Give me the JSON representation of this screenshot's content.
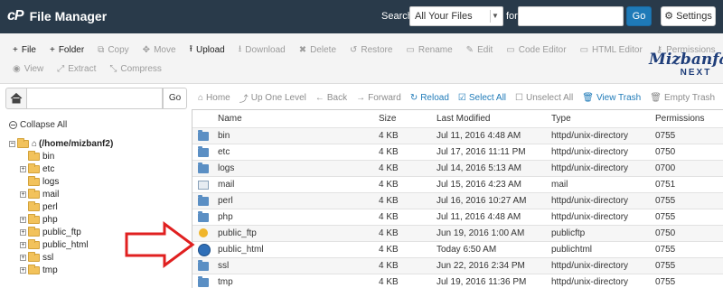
{
  "header": {
    "logo": "cP",
    "title": "File Manager",
    "search_label": "Search",
    "search_scope": "All Your Files",
    "for_label": "for",
    "search_value": "",
    "go_label": "Go",
    "settings_label": "Settings"
  },
  "toolbar": {
    "row1": [
      {
        "icon": "plus-icon",
        "glyph": "+",
        "label": "File",
        "enabled": true
      },
      {
        "icon": "plus-icon",
        "glyph": "+",
        "label": "Folder",
        "enabled": true
      },
      {
        "icon": "copy-icon",
        "glyph": "⧉",
        "label": "Copy",
        "enabled": false
      },
      {
        "icon": "move-icon",
        "glyph": "✥",
        "label": "Move",
        "enabled": false
      },
      {
        "icon": "upload-icon",
        "glyph": "⭱",
        "label": "Upload",
        "enabled": true
      },
      {
        "icon": "download-icon",
        "glyph": "⭳",
        "label": "Download",
        "enabled": false
      },
      {
        "icon": "delete-icon",
        "glyph": "✖",
        "label": "Delete",
        "enabled": false
      },
      {
        "icon": "restore-icon",
        "glyph": "↺",
        "label": "Restore",
        "enabled": false
      },
      {
        "icon": "rename-icon",
        "glyph": "▭",
        "label": "Rename",
        "enabled": false
      },
      {
        "icon": "edit-icon",
        "glyph": "✎",
        "label": "Edit",
        "enabled": false
      },
      {
        "icon": "code-editor-icon",
        "glyph": "▭",
        "label": "Code Editor",
        "enabled": false
      },
      {
        "icon": "html-editor-icon",
        "glyph": "▭",
        "label": "HTML Editor",
        "enabled": false
      },
      {
        "icon": "permissions-icon",
        "glyph": "⚷",
        "label": "Permissions",
        "enabled": false
      }
    ],
    "row2": [
      {
        "icon": "view-icon",
        "glyph": "◉",
        "label": "View",
        "enabled": false
      },
      {
        "icon": "extract-icon",
        "glyph": "⤢",
        "label": "Extract",
        "enabled": false
      },
      {
        "icon": "compress-icon",
        "glyph": "⤡",
        "label": "Compress",
        "enabled": false
      }
    ]
  },
  "watermark": {
    "line1": "Mizbanfa",
    "line2": "NEXT"
  },
  "left": {
    "path_value": "",
    "go_label": "Go",
    "collapse_label": "Collapse All",
    "root_label": "(/home/mizbanf2)",
    "tree": [
      {
        "label": "bin",
        "expandable": false
      },
      {
        "label": "etc",
        "expandable": true
      },
      {
        "label": "logs",
        "expandable": false
      },
      {
        "label": "mail",
        "expandable": true
      },
      {
        "label": "perl",
        "expandable": false
      },
      {
        "label": "php",
        "expandable": true
      },
      {
        "label": "public_ftp",
        "expandable": true
      },
      {
        "label": "public_html",
        "expandable": true
      },
      {
        "label": "ssl",
        "expandable": true
      },
      {
        "label": "tmp",
        "expandable": true
      }
    ]
  },
  "nav": [
    {
      "icon": "home-icon",
      "glyph": "⌂",
      "label": "Home",
      "enabled": false
    },
    {
      "icon": "up-level-icon",
      "glyph": "⤴",
      "label": "Up One Level",
      "enabled": false
    },
    {
      "icon": "back-icon",
      "glyph": "←",
      "label": "Back",
      "enabled": false
    },
    {
      "icon": "forward-icon",
      "glyph": "→",
      "label": "Forward",
      "enabled": false
    },
    {
      "icon": "reload-icon",
      "glyph": "↻",
      "label": "Reload",
      "enabled": true
    },
    {
      "icon": "select-all-icon",
      "glyph": "☑",
      "label": "Select All",
      "enabled": true
    },
    {
      "icon": "unselect-all-icon",
      "glyph": "☐",
      "label": "Unselect All",
      "enabled": false
    },
    {
      "icon": "trash-icon",
      "glyph": "🗑",
      "label": "View Trash",
      "enabled": true
    },
    {
      "icon": "trash-icon",
      "glyph": "🗑",
      "label": "Empty Trash",
      "enabled": false
    }
  ],
  "table": {
    "headers": {
      "name": "Name",
      "size": "Size",
      "modified": "Last Modified",
      "type": "Type",
      "permissions": "Permissions"
    },
    "rows": [
      {
        "icon": "folder",
        "name": "bin",
        "size": "4 KB",
        "modified": "Jul 11, 2016 4:48 AM",
        "type": "httpd/unix-directory",
        "perm": "0755"
      },
      {
        "icon": "folder",
        "name": "etc",
        "size": "4 KB",
        "modified": "Jul 17, 2016 11:11 PM",
        "type": "httpd/unix-directory",
        "perm": "0750"
      },
      {
        "icon": "folder",
        "name": "logs",
        "size": "4 KB",
        "modified": "Jul 14, 2016 5:13 AM",
        "type": "httpd/unix-directory",
        "perm": "0700"
      },
      {
        "icon": "mail",
        "name": "mail",
        "size": "4 KB",
        "modified": "Jul 15, 2016 4:23 AM",
        "type": "mail",
        "perm": "0751"
      },
      {
        "icon": "folder",
        "name": "perl",
        "size": "4 KB",
        "modified": "Jul 16, 2016 10:27 AM",
        "type": "httpd/unix-directory",
        "perm": "0755"
      },
      {
        "icon": "folder",
        "name": "php",
        "size": "4 KB",
        "modified": "Jul 11, 2016 4:48 AM",
        "type": "httpd/unix-directory",
        "perm": "0755"
      },
      {
        "icon": "ftp",
        "name": "public_ftp",
        "size": "4 KB",
        "modified": "Jun 19, 2016 1:00 AM",
        "type": "publicftp",
        "perm": "0750"
      },
      {
        "icon": "web",
        "name": "public_html",
        "size": "4 KB",
        "modified": "Today 6:50 AM",
        "type": "publichtml",
        "perm": "0755"
      },
      {
        "icon": "folder",
        "name": "ssl",
        "size": "4 KB",
        "modified": "Jun 22, 2016 2:34 PM",
        "type": "httpd/unix-directory",
        "perm": "0755"
      },
      {
        "icon": "folder",
        "name": "tmp",
        "size": "4 KB",
        "modified": "Jul 19, 2016 11:36 PM",
        "type": "httpd/unix-directory",
        "perm": "0755"
      }
    ]
  },
  "colors": {
    "header_bg": "#293a4a",
    "accent": "#1e7ab8",
    "arrow": "#e02020"
  }
}
